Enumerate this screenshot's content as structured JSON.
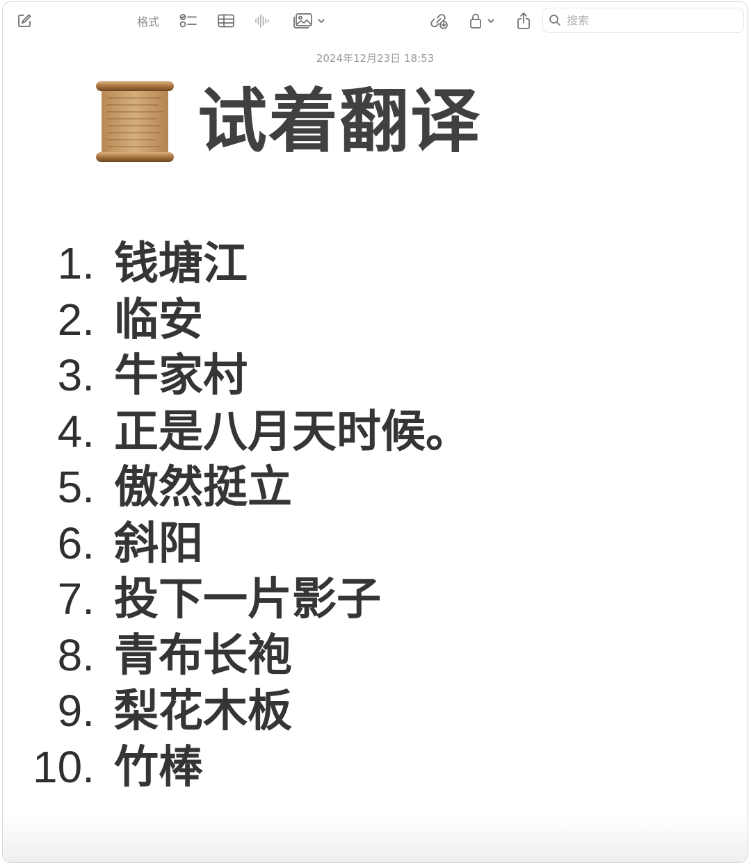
{
  "toolbar": {
    "compose_icon": "compose-icon",
    "format_label": "格式",
    "checklist_icon": "checklist-icon",
    "table_icon": "table-icon",
    "audio_icon": "waveform-icon",
    "media_icon": "photo-icon",
    "collaborate_icon": "collaborate-icon",
    "lock_icon": "lock-icon",
    "share_icon": "share-icon"
  },
  "search": {
    "placeholder": "搜索",
    "value": ""
  },
  "note": {
    "timestamp": "2024年12月23日 18:53",
    "title_emoji": "scroll-emoji",
    "title": "试着翻译",
    "items": [
      {
        "number": "1.",
        "text": "钱塘江"
      },
      {
        "number": "2.",
        "text": "临安"
      },
      {
        "number": "3.",
        "text": "牛家村"
      },
      {
        "number": "4.",
        "text": "正是八月天时候。"
      },
      {
        "number": "5.",
        "text": "傲然挺立"
      },
      {
        "number": "6.",
        "text": "斜阳"
      },
      {
        "number": "7.",
        "text": "投下一片影子"
      },
      {
        "number": "8.",
        "text": "青布长袍"
      },
      {
        "number": "9.",
        "text": "梨花木板"
      },
      {
        "number": "10.",
        "text": "竹棒"
      }
    ]
  },
  "colors": {
    "title": "#404040",
    "text": "#2f2f2f",
    "icon": "#6e6e6e",
    "timestamp": "#9a9a9a"
  }
}
